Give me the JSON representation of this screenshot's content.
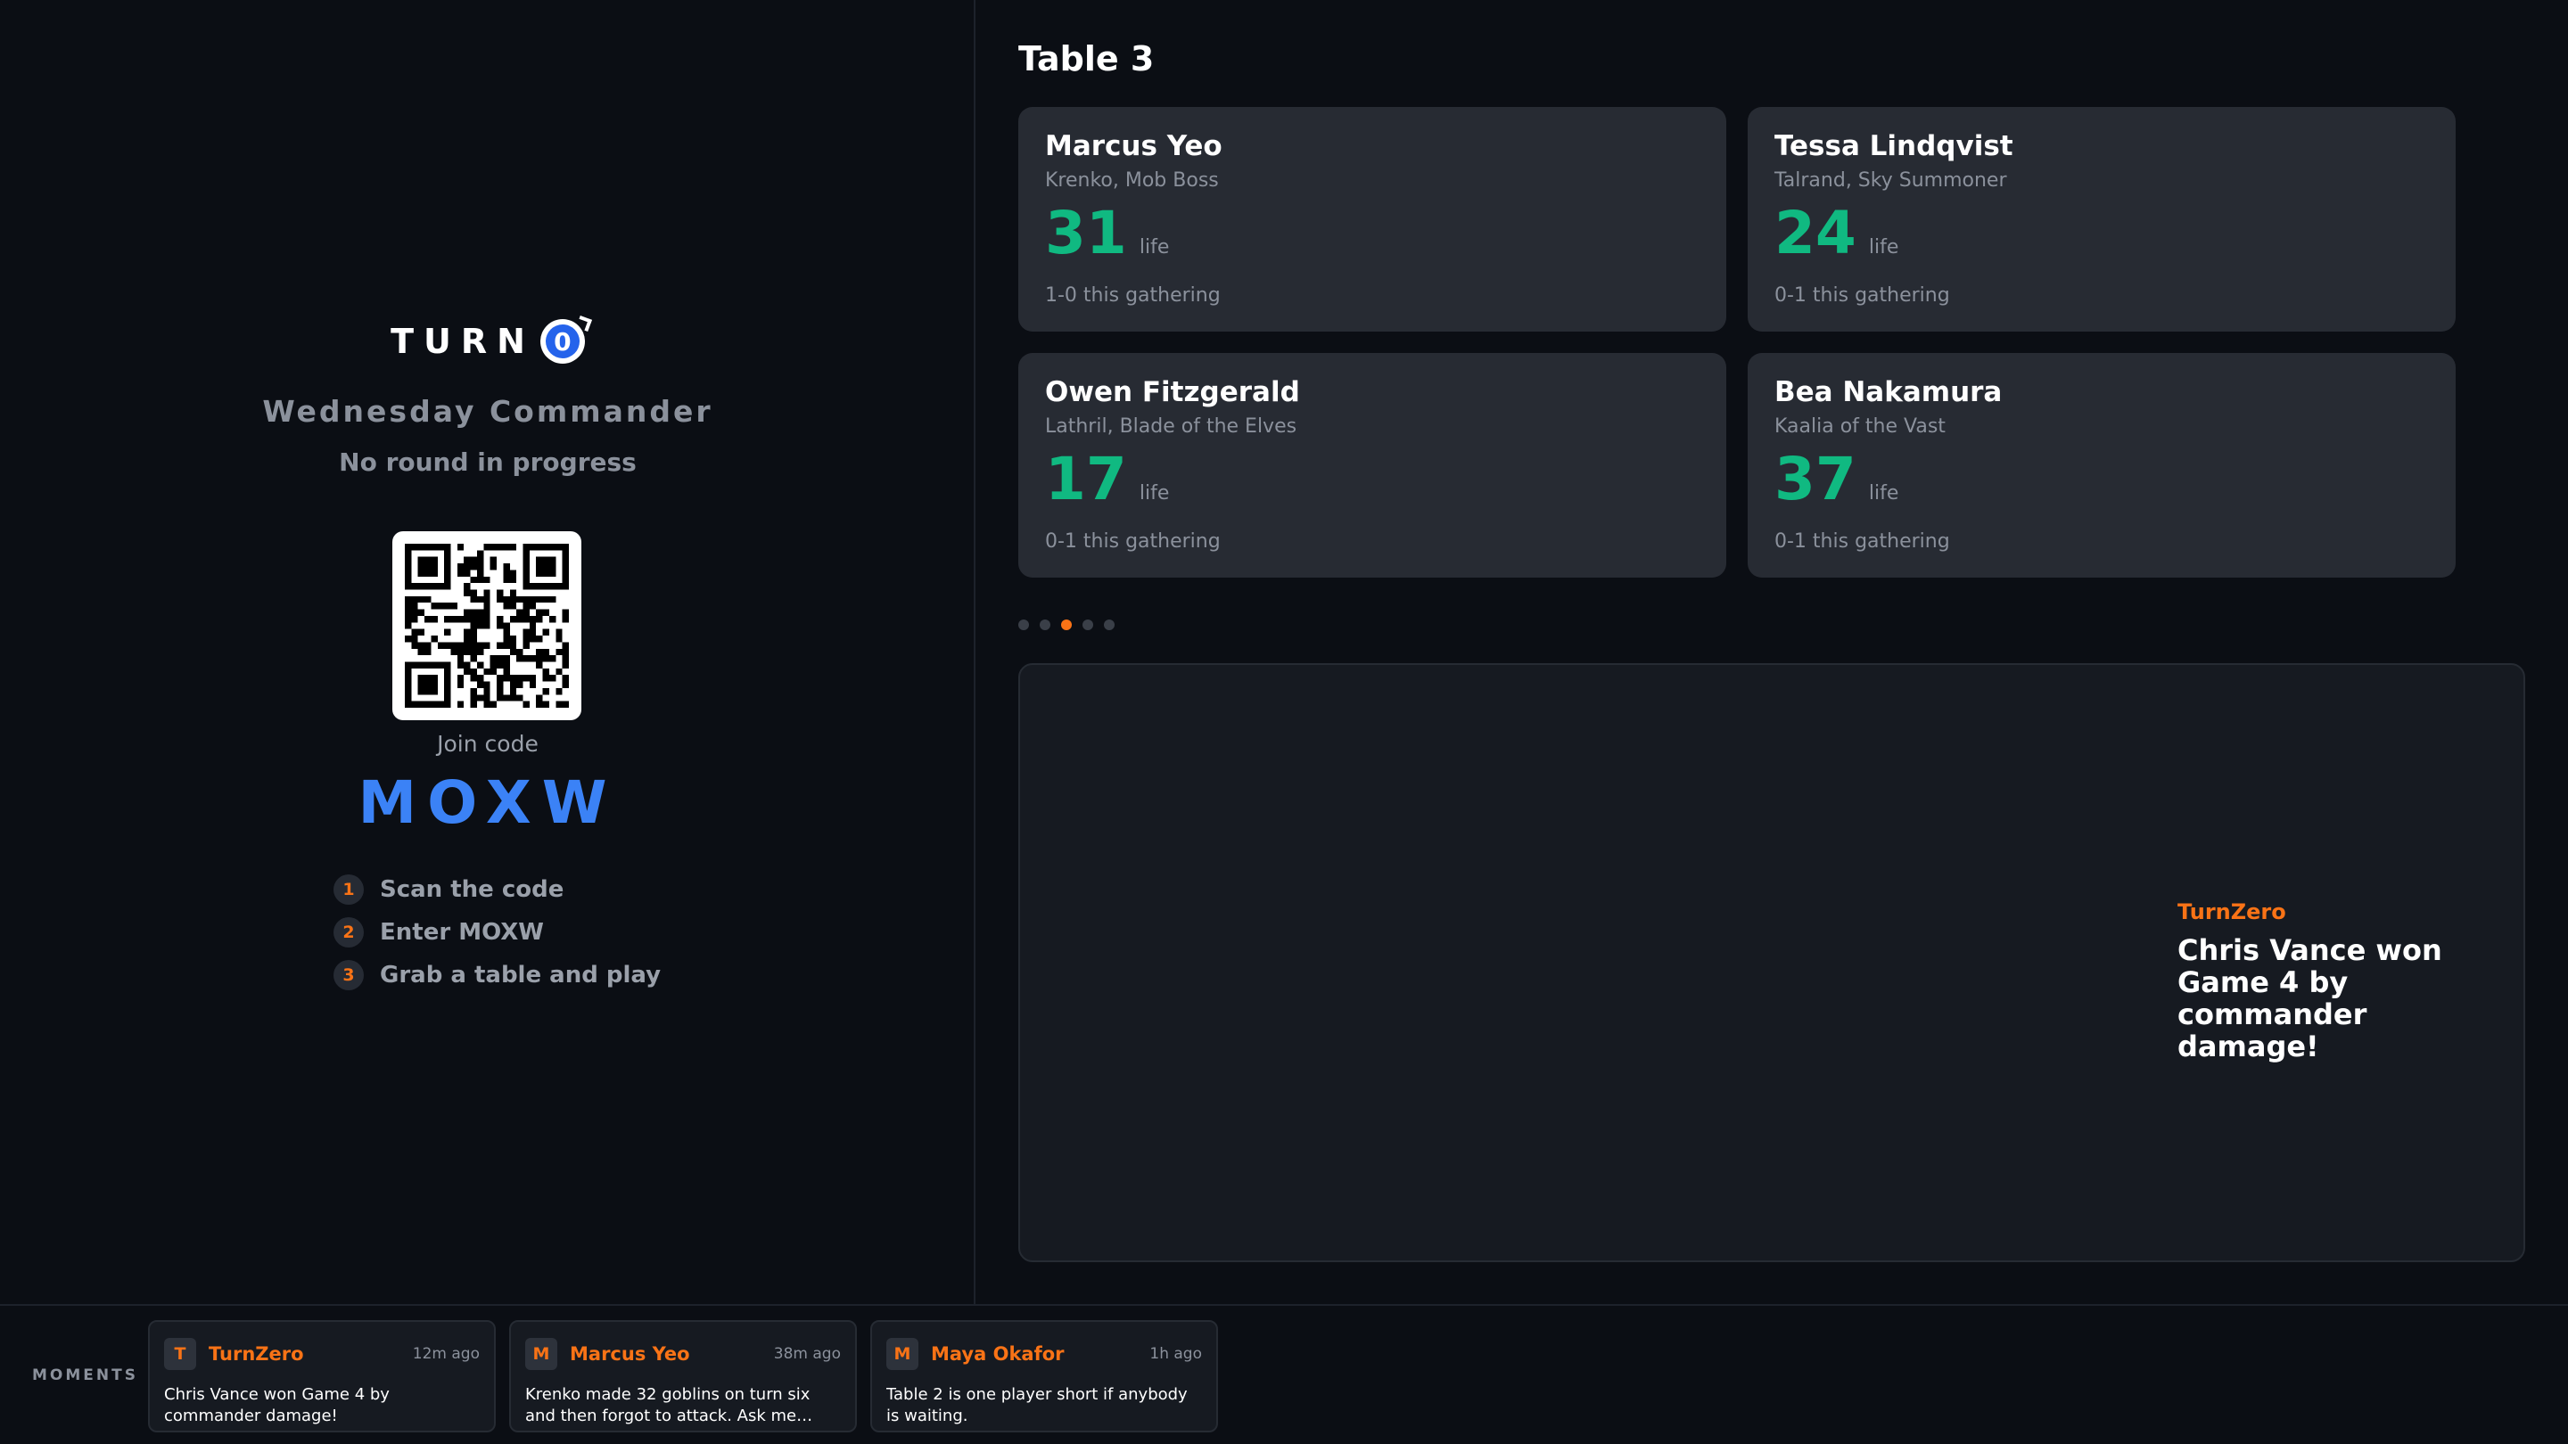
{
  "brand": {
    "logo_text": "TURN",
    "logo_mark": "0"
  },
  "event": {
    "title": "Wednesday Commander",
    "round_status": "No round in progress"
  },
  "join": {
    "label": "Join code",
    "code": "MOXW",
    "steps": [
      {
        "num": "1",
        "text": "Scan the code"
      },
      {
        "num": "2",
        "text": "Enter MOXW"
      },
      {
        "num": "3",
        "text": "Grab a table and play"
      }
    ]
  },
  "table": {
    "title": "Table 3",
    "life_label": "life",
    "players": [
      {
        "name": "Marcus Yeo",
        "commander": "Krenko, Mob Boss",
        "life": "31",
        "record": "1-0 this gathering"
      },
      {
        "name": "Tessa Lindqvist",
        "commander": "Talrand, Sky Summoner",
        "life": "24",
        "record": "0-1 this gathering"
      },
      {
        "name": "Owen Fitzgerald",
        "commander": "Lathril, Blade of the Elves",
        "life": "17",
        "record": "0-1 this gathering"
      },
      {
        "name": "Bea Nakamura",
        "commander": "Kaalia of the Vast",
        "life": "37",
        "record": "0-1 this gathering"
      }
    ]
  },
  "carousel": {
    "count": 5,
    "active_index": 2
  },
  "spotlight": {
    "source": "TurnZero",
    "text": "Chris Vance won Game 4 by commander damage!"
  },
  "moments": {
    "label": "MOMENTS",
    "items": [
      {
        "avatar": "T",
        "name": "TurnZero",
        "time": "12m ago",
        "text": "Chris Vance won Game 4 by commander damage!"
      },
      {
        "avatar": "M",
        "name": "Marcus Yeo",
        "time": "38m ago",
        "text": "Krenko made 32 goblins on turn six and then forgot to attack. Ask me…"
      },
      {
        "avatar": "M",
        "name": "Maya Okafor",
        "time": "1h ago",
        "text": "Table 2 is one player short if anybody is waiting."
      }
    ]
  },
  "colors": {
    "accent": "#f97316",
    "life": "#10b981",
    "code": "#3b82f6",
    "background": "#0b0e14"
  }
}
